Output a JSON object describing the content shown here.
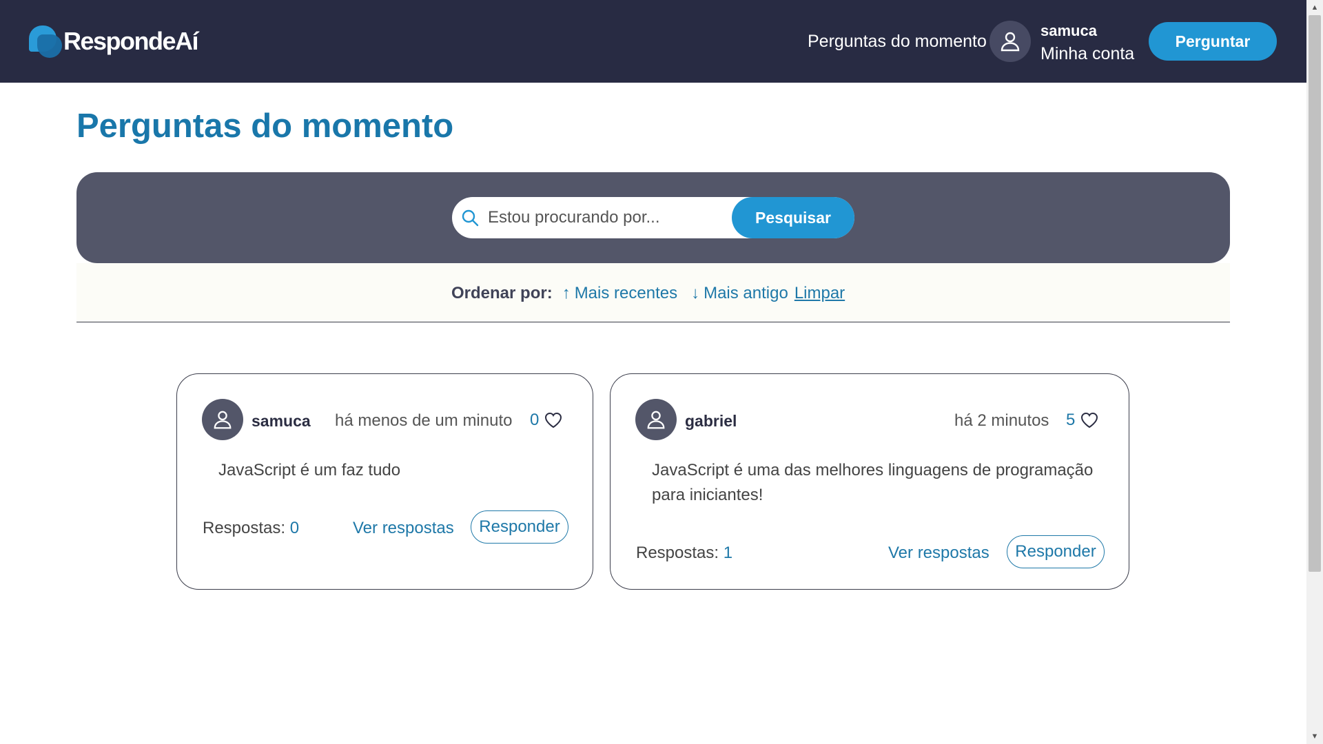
{
  "header": {
    "logo_text": "RespondeAí",
    "nav_link": "Perguntas do momento",
    "user": {
      "name": "samuca",
      "account_label": "Minha conta"
    },
    "ask_button": "Perguntar"
  },
  "main": {
    "title": "Perguntas do momento",
    "search": {
      "placeholder": "Estou procurando por...",
      "value": "",
      "button": "Pesquisar"
    },
    "sort": {
      "label": "Ordenar por:",
      "options": [
        {
          "arrow": "↑",
          "label": "Mais recentes"
        },
        {
          "arrow": "↓",
          "label": "Mais antigo"
        }
      ],
      "clear": "Limpar"
    },
    "questions": [
      {
        "user": "samuca",
        "time": "há menos de um minuto",
        "likes": "0",
        "text": "JavaScript é um faz tudo",
        "answers_label": "Respostas:",
        "answers_count": "0",
        "view_label": "Ver respostas",
        "reply_label": "Responder"
      },
      {
        "user": "gabriel",
        "time": "há 2 minutos",
        "likes": "5",
        "text": "JavaScript é uma das melhores linguagens de programação para iniciantes!",
        "answers_label": "Respostas:",
        "answers_count": "1",
        "view_label": "Ver respostas",
        "reply_label": "Responder"
      }
    ]
  },
  "colors": {
    "header_bg": "#282b43",
    "accent": "#2196d3",
    "title": "#1977aa",
    "search_panel": "#535669",
    "link": "#1e78a8"
  },
  "icons": {
    "avatar": "user-icon",
    "search": "search-icon",
    "like": "heart-icon"
  }
}
